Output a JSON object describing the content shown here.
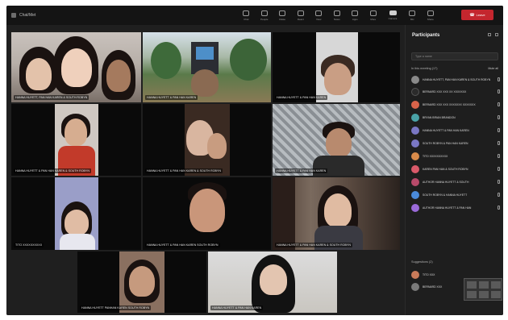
{
  "titlebar": {
    "meeting_title": "Chat/Met",
    "toolbar": [
      {
        "label": "Chat",
        "icon": "chat-icon"
      },
      {
        "label": "People",
        "icon": "people-icon"
      },
      {
        "label": "Raise",
        "icon": "raise-hand-icon"
      },
      {
        "label": "React",
        "icon": "react-icon"
      },
      {
        "label": "View",
        "icon": "view-icon"
      },
      {
        "label": "Notes",
        "icon": "notes-icon"
      },
      {
        "label": "Apps",
        "icon": "apps-icon"
      },
      {
        "label": "More",
        "icon": "more-icon"
      },
      {
        "label": "Camera",
        "icon": "camera-icon"
      },
      {
        "label": "Mic",
        "icon": "mic-icon"
      },
      {
        "label": "Share",
        "icon": "share-icon"
      }
    ],
    "leave_label": "Leave"
  },
  "tiles": [
    {
      "name": "HANNA HUYETT, PAN HAN KAREN & SOUTH ROBYN"
    },
    {
      "name": "HANNA HUYETT & PAN HAN KAREN"
    },
    {
      "name": "HANNA HUYETT & PAN HAN KAREN"
    },
    {
      "name": "HANNA HUYETT & PAN HAN KAREN & SOUTH ROBYN"
    },
    {
      "name": "HANNA HUYETT & PAN HAN KAREN & SOUTH ROBYN"
    },
    {
      "name": "HANNA HUYETT & PAN HAN KAREN"
    },
    {
      "name": "TITO XXXXXXXXXX"
    },
    {
      "name": "HANNA HUYETT & PAN HAN KAREN SOUTH ROBYN"
    },
    {
      "name": "HANNA HUYETT & PAN HAN KAREN & SOUTH ROBYN"
    },
    {
      "name": "HANNA HUYETT PANHAN KAREN SOUTH ROBYN"
    },
    {
      "name": "HANNA HUYETT & PAN HAN KAREN"
    }
  ],
  "panel": {
    "title": "Participants",
    "search_placeholder": "Type a name",
    "in_meeting_label": "In this meeting (17)",
    "mute_all_label": "Mute all",
    "participants": [
      {
        "name": "HANNA HUYETT, PAN HAN KAREN & SOUTH ROBYN",
        "color": "#8a8a8a"
      },
      {
        "name": "BERNARD XXX XXX XX XXXXXXX",
        "color": "#2b2b2b"
      },
      {
        "name": "BERNARD XXX XXX XXXXXXX XXXXXXX",
        "color": "#d9634a"
      },
      {
        "name": "BRYAN BRIAN BRANDON",
        "color": "#4aa3a8"
      },
      {
        "name": "HANNA HUYETT & PAN HAN KAREN",
        "color": "#7a77c4"
      },
      {
        "name": "SOUTH ROBYN & PAN HAN KAREN",
        "color": "#7a77c4"
      },
      {
        "name": "TITO XXXXXXXXXX",
        "color": "#d98b4a"
      },
      {
        "name": "KAREN PAN HAN & SOUTH ROBYN",
        "color": "#d95a6a"
      },
      {
        "name": "AUTHOR HANNA HUYETT & SOUTH",
        "color": "#b84a6a"
      },
      {
        "name": "SOUTH ROBYN & HANNA HUYETT",
        "color": "#4a8ad9"
      },
      {
        "name": "AUTHOR HANNA HUYETT & PAN HAN",
        "color": "#9a6ad9"
      }
    ],
    "suggestions_label": "Suggestions (2)",
    "suggestions": [
      {
        "name": "TITO XXX",
        "color": "#c97b5a"
      },
      {
        "name": "BERNARD XXX",
        "color": "#7a7a7a"
      }
    ]
  }
}
